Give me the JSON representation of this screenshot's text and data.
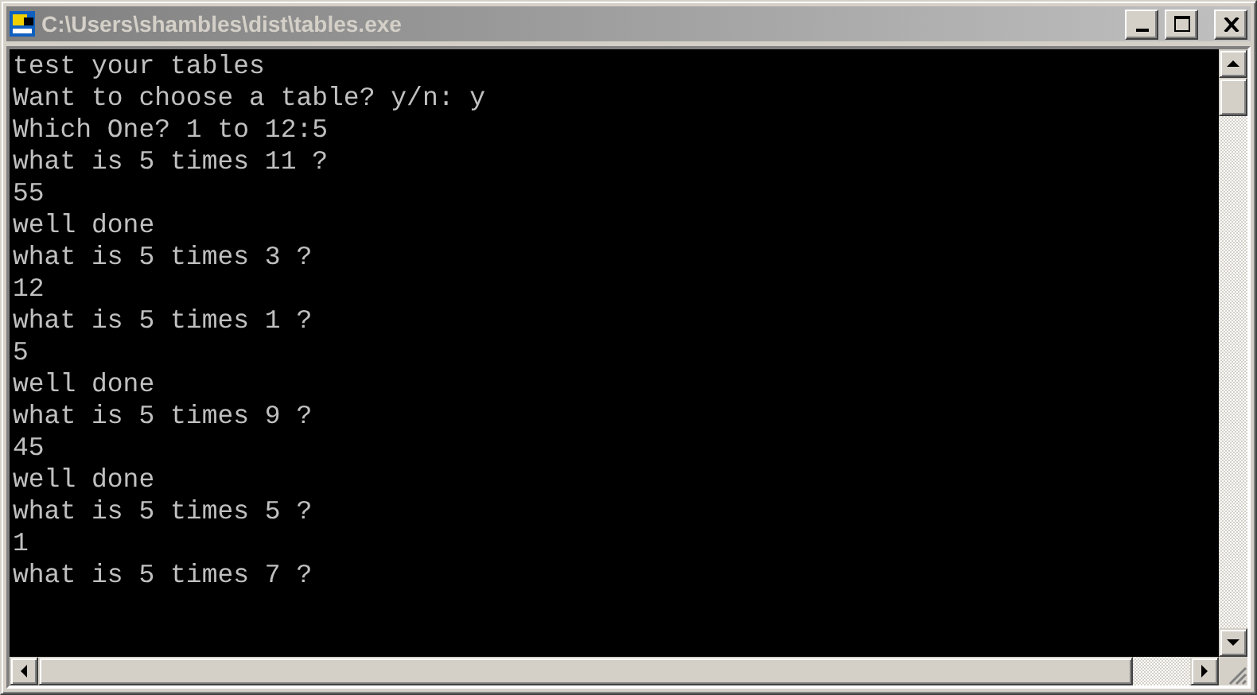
{
  "window": {
    "title": "C:\\Users\\shambles\\dist\\tables.exe",
    "active": false
  },
  "console": {
    "lines": [
      "test your tables",
      "Want to choose a table? y/n: y",
      "Which One? 1 to 12:5",
      "what is 5 times 11 ?",
      "55",
      "well done",
      "what is 5 times 3 ?",
      "12",
      "what is 5 times 1 ?",
      "5",
      "well done",
      "what is 5 times 9 ?",
      "45",
      "well done",
      "what is 5 times 5 ?",
      "1",
      "what is 5 times 7 ?"
    ]
  }
}
